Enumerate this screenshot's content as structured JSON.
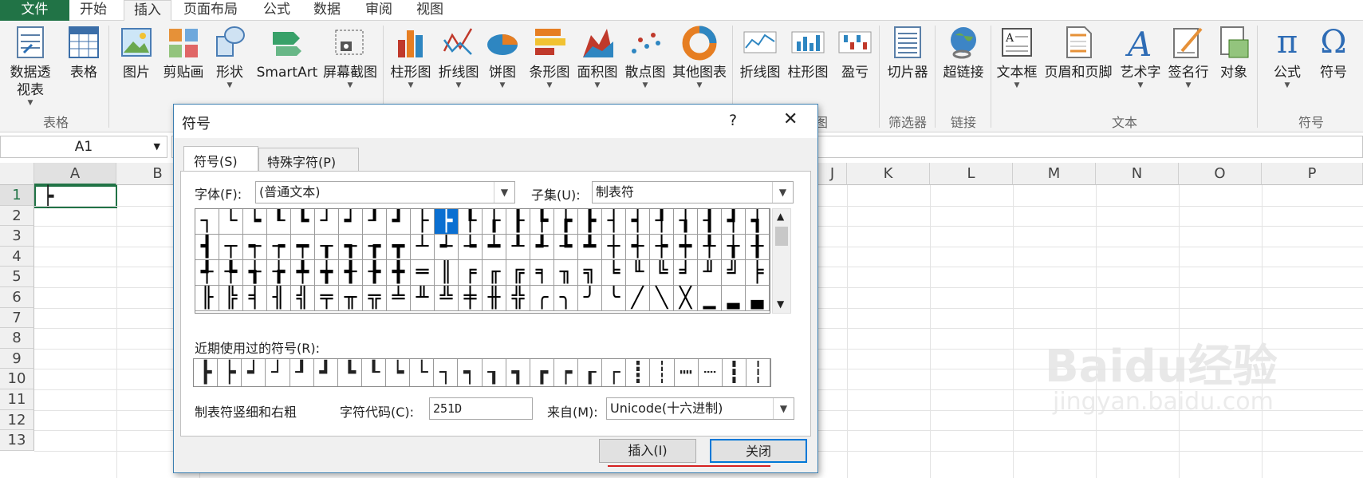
{
  "tabs": [
    "文件",
    "开始",
    "插入",
    "页面布局",
    "公式",
    "数据",
    "审阅",
    "视图"
  ],
  "ribbon": {
    "buttons": [
      "数据透视表",
      "表格",
      "图片",
      "剪贴画",
      "形状",
      "SmartArt",
      "屏幕截图",
      "柱形图",
      "折线图",
      "饼图",
      "条形图",
      "面积图",
      "散点图",
      "其他图表",
      "折线图",
      "柱形图",
      "盈亏",
      "切片器",
      "超链接",
      "文本框",
      "页眉和页脚",
      "艺术字",
      "签名行",
      "对象",
      "公式",
      "符号"
    ],
    "groups": [
      "表格",
      "图",
      "筛选器",
      "链接",
      "文本",
      "符号"
    ]
  },
  "namebox": "A1",
  "columns": [
    "A",
    "B",
    "J",
    "K",
    "L",
    "M",
    "N",
    "O",
    "P"
  ],
  "rows": [
    "1",
    "2",
    "3",
    "4",
    "5",
    "6",
    "7",
    "8",
    "9",
    "10",
    "11",
    "12",
    "13"
  ],
  "cell_a1": "┝",
  "dialog": {
    "title": "符号",
    "help": "?",
    "close": "✕",
    "tabs": [
      "符号(S)",
      "特殊字符(P)"
    ],
    "font_label": "字体(F):",
    "font_value": "(普通文本)",
    "subset_label": "子集(U):",
    "subset_value": "制表符",
    "symbols": [
      "┐",
      "└",
      "┕",
      "┖",
      "┗",
      "┘",
      "┙",
      "┚",
      "┛",
      "├",
      "┝",
      "┞",
      "┟",
      "┠",
      "┡",
      "┢",
      "┣",
      "┤",
      "┥",
      "┦",
      "┧",
      "┨",
      "┩",
      "┪",
      "┫",
      "┬",
      "┭",
      "┮",
      "┯",
      "┰",
      "┱",
      "┲",
      "┳",
      "┴",
      "┵",
      "┶",
      "┷",
      "┸",
      "┹",
      "┺",
      "┻",
      "┼",
      "┽",
      "┾",
      "┿",
      "╀",
      "╁",
      "╂",
      "╃",
      "╄",
      "╅",
      "╆",
      "╇",
      "╈",
      "╉",
      "╊",
      "╋",
      "═",
      "║",
      "╒",
      "╓",
      "╔",
      "╕",
      "╖",
      "╗",
      "╘",
      "╙",
      "╚",
      "╛",
      "╜",
      "╝",
      "╞",
      "╟",
      "╠",
      "╡",
      "╢",
      "╣",
      "╤",
      "╥",
      "╦",
      "╧",
      "╨",
      "╩",
      "╪",
      "╫",
      "╬",
      "╭",
      "╮",
      "╯",
      "╰",
      "╱",
      "╲",
      "╳",
      "▁",
      "▂",
      "▃"
    ],
    "selected_index": 10,
    "recent_label": "近期使用过的符号(R):",
    "recent": [
      "┣",
      "┝",
      "┙",
      "┘",
      "┚",
      "┛",
      "┗",
      "┖",
      "┕",
      "└",
      "┐",
      "┑",
      "┒",
      "┓",
      "┏",
      "┍",
      "┎",
      "┌",
      "┋",
      "┊",
      "┉",
      "┈",
      "┇",
      "┆"
    ],
    "char_name": "制表符竖细和右粗",
    "code_label": "字符代码(C):",
    "code_value": "251D",
    "from_label": "来自(M):",
    "from_value": "Unicode(十六进制)",
    "insert_btn": "插入(I)",
    "close_btn": "关闭"
  },
  "watermark": "Baidu经验",
  "watermark_url": "jingyan.baidu.com"
}
